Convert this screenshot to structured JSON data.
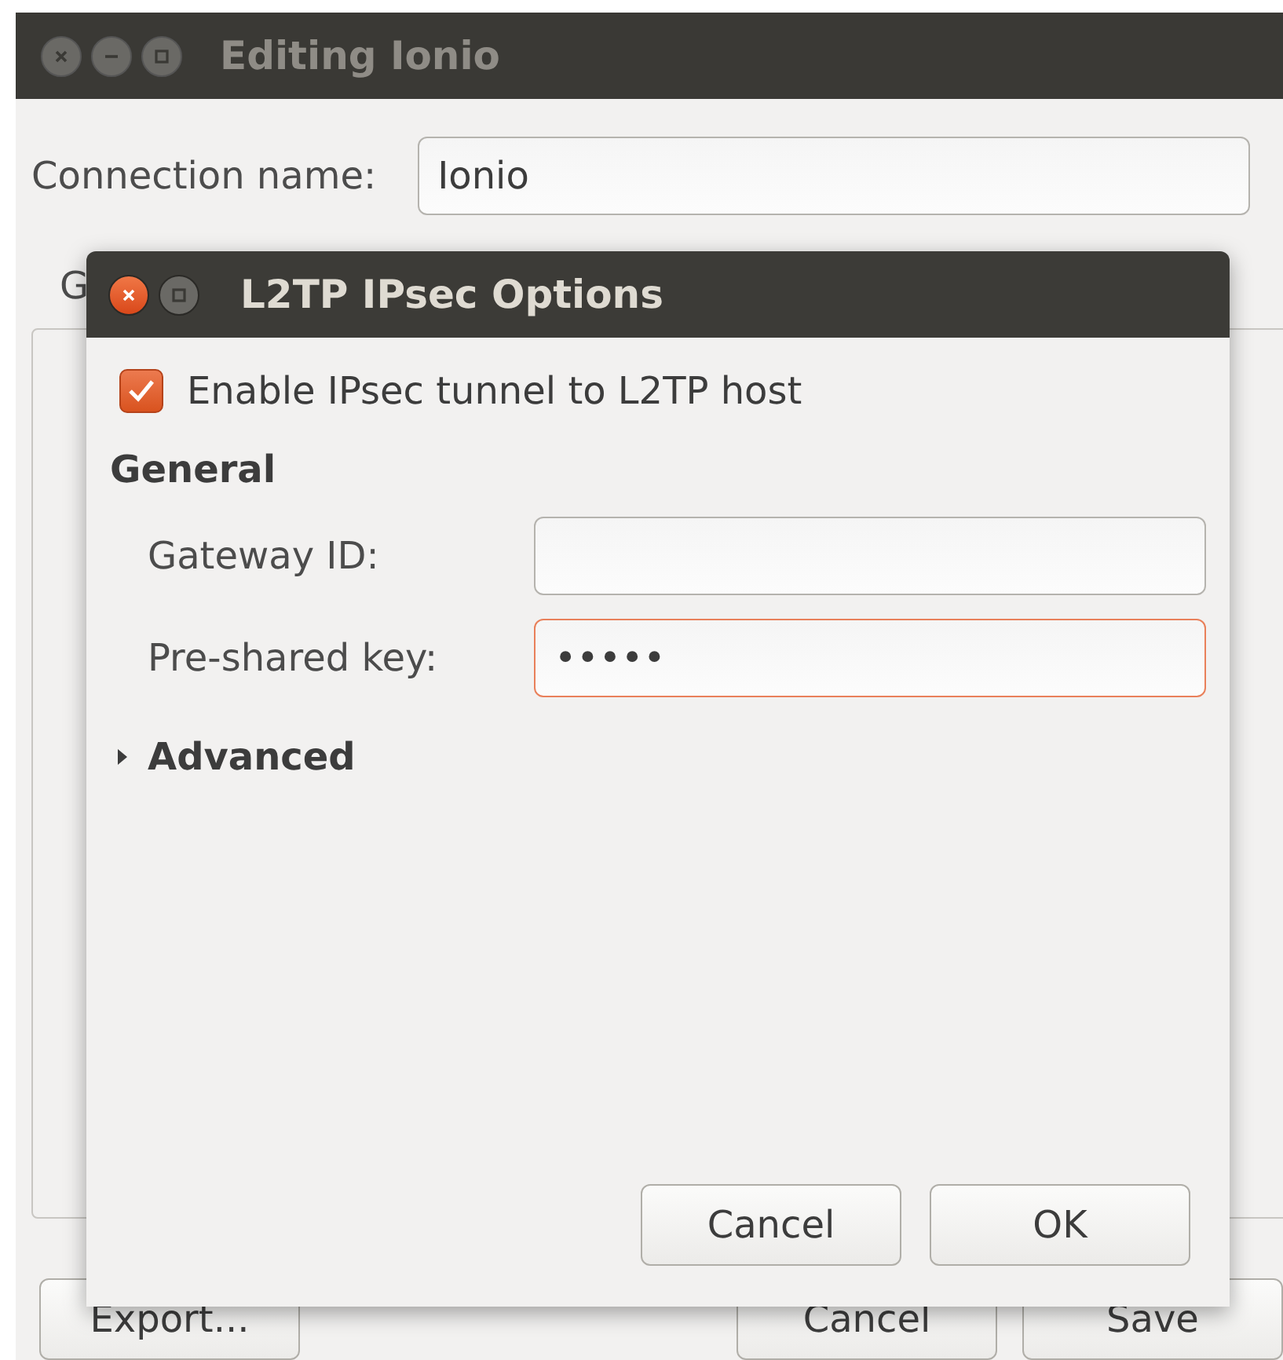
{
  "parent_window": {
    "title": "Editing Ionio",
    "active": false,
    "connection_name": {
      "label": "Connection name:",
      "value": "Ionio"
    },
    "tabs": [
      {
        "label": "G"
      }
    ],
    "buttons": [
      "Export...",
      "Cancel",
      "Save"
    ]
  },
  "dialog": {
    "title": "L2TP IPsec Options",
    "active": true,
    "checkbox": {
      "label": "Enable IPsec tunnel to L2TP host",
      "checked": true
    },
    "section": "General",
    "fields": [
      {
        "label": "Gateway ID:",
        "focused": false
      },
      {
        "label": "Pre-shared key:",
        "value": "•••••",
        "focused": true
      }
    ],
    "expander": {
      "label": "Advanced",
      "expanded": false
    },
    "buttons": [
      "Cancel",
      "OK"
    ]
  }
}
